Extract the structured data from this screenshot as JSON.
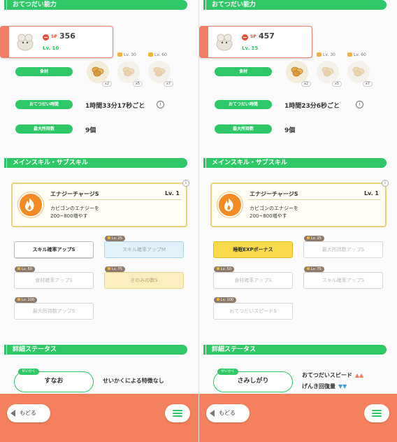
{
  "panels": [
    {
      "help_section_title": "おてつだい能力",
      "sp_label": "SP",
      "sp_value": "356",
      "level": "Lv. 10",
      "ingredients_label": "食材",
      "ingredients": [
        {
          "unlock": "",
          "count": "x2",
          "locked": false
        },
        {
          "unlock": "Lv. 30",
          "count": "x5",
          "locked": true
        },
        {
          "unlock": "Lv. 60",
          "count": "x7",
          "locked": true
        }
      ],
      "help_time_label": "おてつだい時間",
      "help_time_value": "1時間33分17秒ごと",
      "max_carry_label": "最大所持数",
      "max_carry_value": "9個",
      "skills_section_title": "メインスキル・サブスキル",
      "main_skill": {
        "name": "エナジーチャージS",
        "level": "Lv. 1",
        "desc_line1": "カビゴンのエナジーを",
        "desc_line2": "200~800増やす"
      },
      "subskills": [
        {
          "label": "スキル確率アップS",
          "unlock": "",
          "style": "on"
        },
        {
          "label": "スキル確率アップM",
          "unlock": "Lv. 25",
          "style": "blue"
        },
        {
          "label": "食材確率アップS",
          "unlock": "Lv. 50",
          "style": "off"
        },
        {
          "label": "きのみの数S",
          "unlock": "Lv. 75",
          "style": "yellow"
        },
        {
          "label": "最大所持数アップS",
          "unlock": "Lv. 100",
          "style": "off"
        }
      ],
      "detail_section_title": "詳細ステータス",
      "nature_tag": "せいかく",
      "nature": "すなお",
      "nature_effects": [
        {
          "text": "せいかくによる特徴なし",
          "arrows": "",
          "arrow_color": ""
        }
      ],
      "back_label": "もどる"
    },
    {
      "help_section_title": "おてつだい能力",
      "sp_label": "SP",
      "sp_value": "457",
      "level": "Lv. 15",
      "ingredients_label": "食材",
      "ingredients": [
        {
          "unlock": "",
          "count": "x2",
          "locked": false
        },
        {
          "unlock": "Lv. 30",
          "count": "x5",
          "locked": true
        },
        {
          "unlock": "Lv. 60",
          "count": "x7",
          "locked": true
        }
      ],
      "help_time_label": "おてつだい時間",
      "help_time_value": "1時間23分6秒ごと",
      "max_carry_label": "最大所持数",
      "max_carry_value": "9個",
      "skills_section_title": "メインスキル・サブスキル",
      "main_skill": {
        "name": "エナジーチャージS",
        "level": "Lv. 1",
        "desc_line1": "カビゴンのエナジーを",
        "desc_line2": "200~800増やす"
      },
      "subskills": [
        {
          "label": "睡眠EXPボーナス",
          "unlock": "",
          "style": "gold"
        },
        {
          "label": "最大所持数アップS",
          "unlock": "Lv. 25",
          "style": "off"
        },
        {
          "label": "食材確率アップS",
          "unlock": "Lv. 50",
          "style": "off"
        },
        {
          "label": "スキル確率アップS",
          "unlock": "Lv. 75",
          "style": "off"
        },
        {
          "label": "おてつだいスピードS",
          "unlock": "Lv. 100",
          "style": "off"
        }
      ],
      "detail_section_title": "詳細ステータス",
      "nature_tag": "せいかく",
      "nature": "さみしがり",
      "nature_effects": [
        {
          "text": "おてつだいスピード",
          "arrows": "▲▲",
          "arrow_color": "#f07f52"
        },
        {
          "text": "げんき回復量",
          "arrows": "▼▼",
          "arrow_color": "#3a9de0"
        }
      ],
      "back_label": "もどる"
    }
  ]
}
